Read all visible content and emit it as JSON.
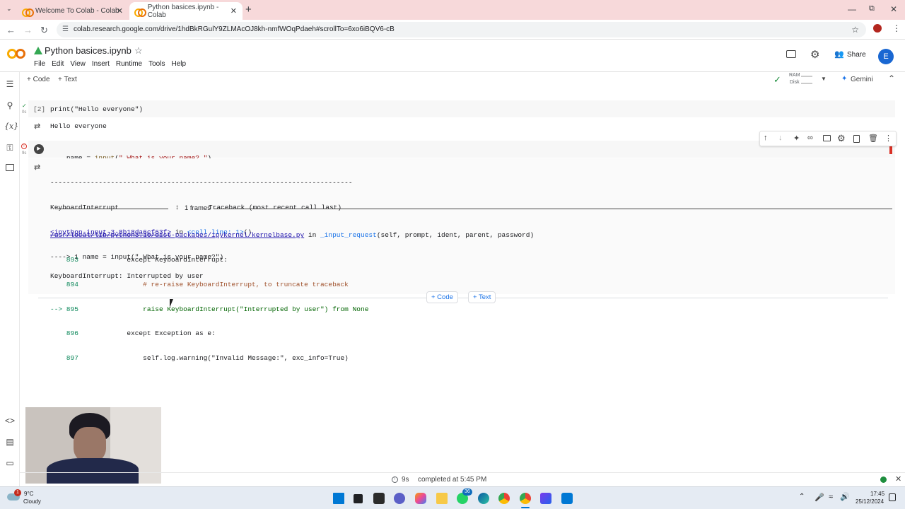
{
  "browser": {
    "tabs": [
      {
        "title": "Welcome To Colab - Colab",
        "active": false
      },
      {
        "title": "Python basices.ipynb - Colab",
        "active": true
      }
    ],
    "url": "colab.research.google.com/drive/1hdBkRGulY9ZLMAcOJ8kh-nmfWOqPdaeh#scrollTo=6xo6iBQV6-cB"
  },
  "colab": {
    "notebook_title": "Python basices.ipynb",
    "menu": [
      "File",
      "Edit",
      "View",
      "Insert",
      "Runtime",
      "Tools",
      "Help"
    ],
    "share_label": "Share",
    "avatar_letter": "E",
    "toolbar": {
      "add_code": "+ Code",
      "add_text": "+ Text",
      "ram_label": "RAM",
      "disk_label": "Disk",
      "gemini_label": "Gemini"
    }
  },
  "cells": [
    {
      "exec_count": "[2]",
      "exec_time": "0s",
      "source": "print(\"Hello everyone\")",
      "output": "Hello everyone"
    },
    {
      "exec_time": "9s",
      "source_var": "name",
      "source_eq": " = ",
      "source_fn": "input",
      "source_str": "\" What is your name? \"",
      "traceback": {
        "dashes": "---------------------------------------------------------------------------",
        "error_name": "KeyboardInterrupt",
        "header_right": "Traceback (most recent call last)",
        "location_link": "<ipython-input-3-8b18da6cf63f>",
        "location_in": " in ",
        "location_cell": "<cell line: 1>",
        "location_paren": "()",
        "arrow_line": "----> 1 name = input(\" What is your name?\")",
        "frames_label": "1 frames",
        "file_link": "/usr/local/lib/python3.10/dist-packages/ipykernel/kernelbase.py",
        "file_in": " in ",
        "file_func": "_input_request",
        "file_args": "(self, prompt, ident, parent, password)",
        "lines": [
          {
            "num": "    893",
            "text": "            except KeyboardInterrupt:"
          },
          {
            "num": "    894",
            "text": "                # re-raise KeyboardInterrupt, to truncate traceback"
          },
          {
            "num": "--> 895",
            "text": "                raise KeyboardInterrupt(\"Interrupted by user\") from None"
          },
          {
            "num": "    896",
            "text": "            except Exception as e:"
          },
          {
            "num": "    897",
            "text": "                self.log.warning(\"Invalid Message:\", exc_info=True)"
          }
        ],
        "final": "KeyboardInterrupt: Interrupted by user"
      }
    }
  ],
  "between_cells": {
    "code": "+ Code",
    "text": "+ Text"
  },
  "status": {
    "time": "9s",
    "message": "completed at 5:45 PM"
  },
  "taskbar": {
    "weather_temp": "9°C",
    "weather_desc": "Cloudy",
    "weather_badge": "1",
    "chat_badge": "36",
    "clock_time": "17:45",
    "clock_date": "25/12/2024"
  },
  "icons": {
    "sidebar": [
      "toc-icon",
      "search-icon",
      "variables-icon",
      "secrets-key-icon",
      "folder-icon",
      "code-snippets-icon",
      "command-palette-icon",
      "terminal-icon"
    ],
    "cell_toolbar": [
      "move-up-icon",
      "move-down-icon",
      "gemini-sparkle-icon",
      "link-icon",
      "comment-icon",
      "settings-icon",
      "mirror-cell-icon",
      "delete-icon",
      "more-icon"
    ]
  }
}
